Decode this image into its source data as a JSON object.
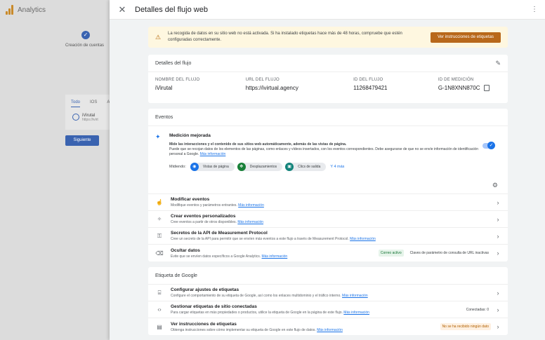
{
  "background": {
    "app_title": "Analytics",
    "step_label": "Creación de cuentas",
    "tabs": [
      "Todo",
      "IOS",
      "A"
    ],
    "row_title": "iVirutal",
    "row_sub": "https://ivirt",
    "next_button": "Siguiente"
  },
  "drawer": {
    "title": "Detalles del flujo web"
  },
  "warning": {
    "text": "La recogida de datos en su sitio web no está activada. Si ha instalado etiquetas hace más de 48 horas, compruebe que estén configuradas correctamente.",
    "button": "Ver instrucciones de etiquetas"
  },
  "stream_details": {
    "title": "Detalles del flujo",
    "fields": [
      {
        "label": "NOMBRE DEL FLUJO",
        "value": "iVirutal"
      },
      {
        "label": "URL DEL FLUJO",
        "value": "https://ivirtual.agency"
      },
      {
        "label": "ID DEL FLUJO",
        "value": "11268479421"
      },
      {
        "label": "ID DE MEDICIÓN",
        "value": "G-1N8XNN870C"
      }
    ]
  },
  "events": {
    "title": "Eventos",
    "enhanced": {
      "title": "Medición mejorada",
      "desc_bold": "Mide las interacciones y el contenido de sus sitios web automáticamente, además de las vistas de página.",
      "desc": "Puede que se recojan datos de los elementos de las páginas, como enlaces y vídeos insertados, con los eventos correspondientes. Debe asegurarse de que no se envíe información de identificación personal a Google.",
      "desc_link": "Más información",
      "measuring_label": "Midiendo:",
      "chips": [
        "Vistas de página",
        "Desplazamientos",
        "Clics de salida"
      ],
      "more": "Y 4 más"
    },
    "rows": [
      {
        "title": "Modificar eventos",
        "sub": "Modifique eventos y parámetros entrantes.",
        "link": "Más información"
      },
      {
        "title": "Crear eventos personalizados",
        "sub": "Cree eventos a partir de otros disponibles.",
        "link": "Más información"
      },
      {
        "title": "Secretos de la API de Measurement Protocol",
        "sub": "Cree un secreto de la API para permitir que se envíen más eventos a este flujo a través de Measurement Protocol.",
        "link": "Más información"
      },
      {
        "title": "Ocultar datos",
        "sub": "Evite que se envíen datos específicos a Google Analytics.",
        "link": "Más información",
        "badge1": "Correo activo",
        "badge2": "Claves de parámetro de consulta de URL inactivas"
      }
    ]
  },
  "google_tag": {
    "title": "Etiqueta de Google",
    "rows": [
      {
        "title": "Configurar ajustes de etiquetas",
        "sub": "Configure el comportamiento de su etiqueta de Google, así como los enlaces multidominio y el tráfico interno.",
        "link": "Más información"
      },
      {
        "title": "Gestionar etiquetas de sitio conectadas",
        "sub": "Para cargar etiquetas en más propiedades o productos, utilice la etiqueta de Google en la página de este flujo.",
        "link": "Más información",
        "badge": "Conectadas: 0"
      },
      {
        "title": "Ver instrucciones de etiquetas",
        "sub": "Obtenga instrucciones sobre cómo implementar su etiqueta de Google en este flujo de datos.",
        "link": "Más información",
        "badge": "No se ha recibido ningún dato"
      }
    ]
  }
}
